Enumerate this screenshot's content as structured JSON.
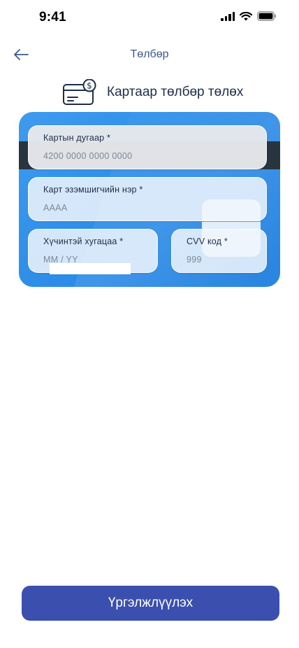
{
  "status_bar": {
    "time": "9:41",
    "icons": [
      "cellular-signal-icon",
      "wifi-icon",
      "battery-icon"
    ]
  },
  "nav": {
    "title": "Төлбөр",
    "back_icon": "arrow-left-icon"
  },
  "section": {
    "icon": "credit-card-dollar-icon",
    "title": "Картаар төлбөр төлөх"
  },
  "form": {
    "card_number": {
      "label": "Картын дугаар *",
      "placeholder": "4200 0000 0000 0000"
    },
    "card_holder": {
      "label": "Карт эзэмшигчийн нэр *",
      "placeholder": "АААА"
    },
    "expiry": {
      "label": "Хүчинтэй хугацаа *",
      "placeholder": "MM / YY"
    },
    "cvv": {
      "label": "CVV код *",
      "placeholder": "999"
    }
  },
  "continue_button": {
    "label": "Үргэлжлүүлэх"
  },
  "colors": {
    "primary": "#3b4fae",
    "card": "#2a8ae6",
    "stripe": "#27353f",
    "title": "#3a5a8c"
  }
}
